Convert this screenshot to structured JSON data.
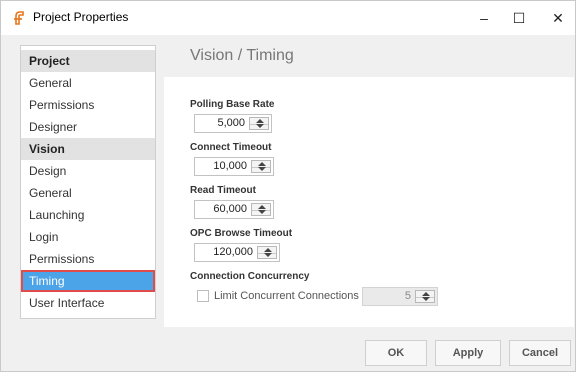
{
  "window": {
    "title": "Project Properties",
    "controls": {
      "minimize": "–",
      "maximize": "☐",
      "close": "✕"
    }
  },
  "sidebar": {
    "items": [
      {
        "label": "Project",
        "type": "header"
      },
      {
        "label": "General",
        "type": "item"
      },
      {
        "label": "Permissions",
        "type": "item"
      },
      {
        "label": "Designer",
        "type": "item"
      },
      {
        "label": "Vision",
        "type": "header"
      },
      {
        "label": "Design",
        "type": "item"
      },
      {
        "label": "General",
        "type": "item"
      },
      {
        "label": "Launching",
        "type": "item"
      },
      {
        "label": "Login",
        "type": "item"
      },
      {
        "label": "Permissions",
        "type": "item"
      },
      {
        "label": "Timing",
        "type": "item",
        "selected": true
      },
      {
        "label": "User Interface",
        "type": "item"
      }
    ]
  },
  "panel": {
    "title": "Vision / Timing",
    "fields": [
      {
        "label": "Polling Base Rate",
        "value": "5,000"
      },
      {
        "label": "Connect Timeout",
        "value": "10,000"
      },
      {
        "label": "Read Timeout",
        "value": "60,000"
      },
      {
        "label": "OPC Browse Timeout",
        "value": "120,000"
      }
    ],
    "concurrency": {
      "label": "Connection Concurrency",
      "checkbox_label": "Limit Concurrent Connections",
      "checked": false,
      "value": "5"
    }
  },
  "buttons": {
    "ok": "OK",
    "apply": "Apply",
    "cancel": "Cancel"
  },
  "colors": {
    "selection": "#4ba3e8",
    "highlight_outline": "#e04b4b"
  }
}
